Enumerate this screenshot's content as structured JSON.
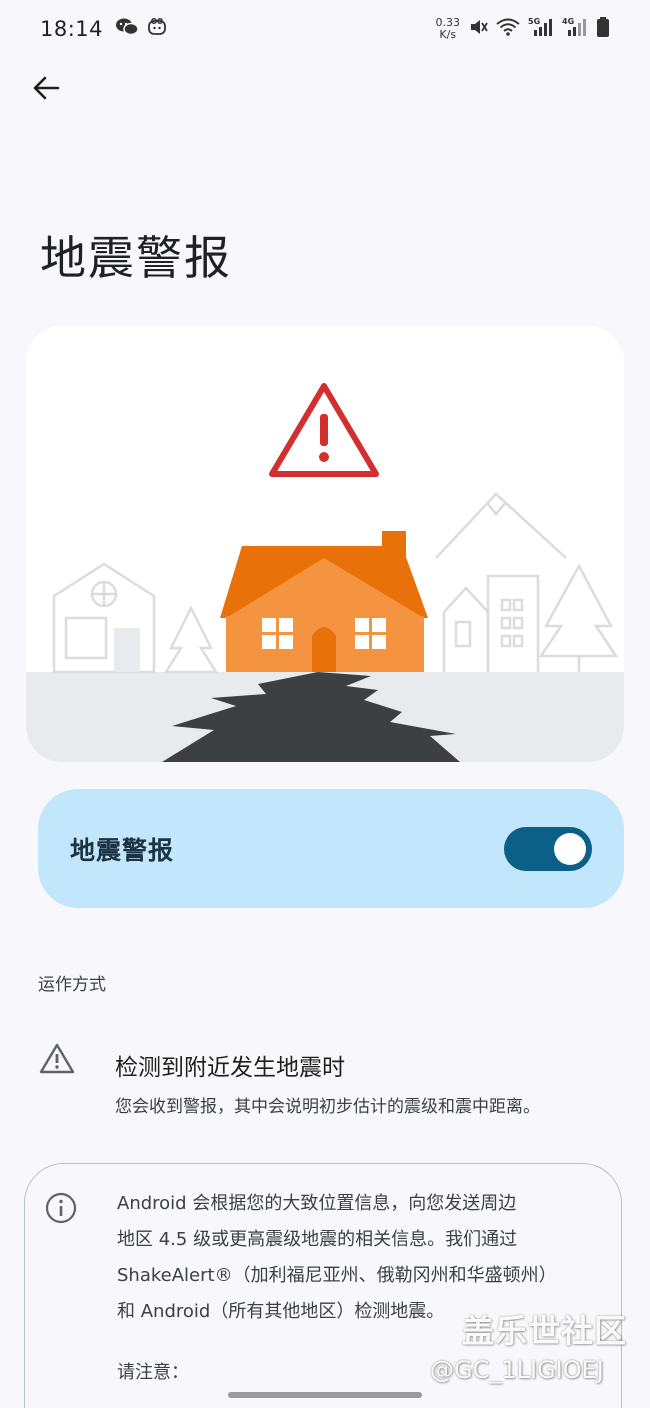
{
  "status_bar": {
    "time": "18:14",
    "net_speed_value": "0.33",
    "net_speed_unit": "K/s",
    "network_1": "5G",
    "network_2": "4G",
    "icons": [
      "wechat-icon",
      "app-notification-icon",
      "mute-icon",
      "wifi-icon",
      "signal-5g-icon",
      "signal-4g-icon",
      "battery-icon"
    ]
  },
  "header": {
    "back_icon": "arrow-left-icon",
    "title": "地震警报"
  },
  "hero": {
    "illustration": "earthquake-house-crack",
    "colors": {
      "warning_red": "#d32f2f",
      "house_orange": "#f08a2c",
      "roof_orange": "#e8710a",
      "crack": "#3c4043"
    }
  },
  "toggle": {
    "label": "地震警报",
    "state": "on",
    "accent": "#0c5f86"
  },
  "how_it_works": {
    "header": "运作方式",
    "items": [
      {
        "icon": "warning-triangle-icon",
        "title": "检测到附近发生地震时",
        "desc": "您会收到警报，其中会说明初步估计的震级和震中距离。"
      }
    ]
  },
  "info": {
    "icon": "info-icon",
    "lines": [
      "Android 会根据您的大致位置信息，向您发送周边",
      "地区 4.5 级或更高震级地震的相关信息。我们通过",
      "ShakeAlert®（加利福尼亚州、俄勒冈州和华盛顿州）",
      "和 Android（所有其他地区）检测地震。"
    ],
    "note": "请注意："
  },
  "watermark": {
    "site": "盖乐世社区",
    "user": "@GC_1LIGIOEJ"
  }
}
